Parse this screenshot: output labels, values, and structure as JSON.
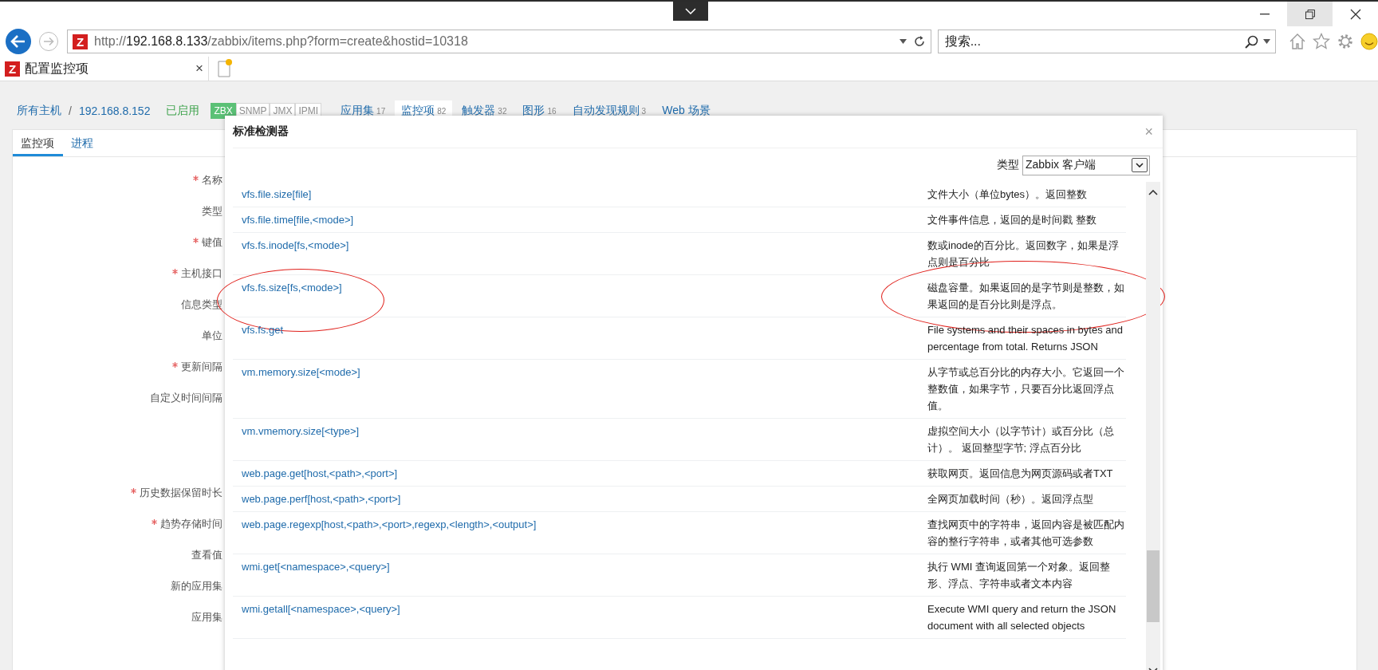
{
  "browser": {
    "favicon": "Z",
    "url": "http://**192.168.8.133**/zabbix/items.php?form=create&hostid=10318",
    "search": {
      "placeholder": "搜索..."
    }
  },
  "tab": {
    "favicon": "Z",
    "title": "配置监控项",
    "close": "×"
  },
  "host_nav": {
    "breadcrumb": [
      "所有主机",
      "192.168.8.152"
    ],
    "separator": "/",
    "status": "已启用",
    "availability": [
      {
        "label": "ZBX",
        "on": true
      },
      {
        "label": "SNMP",
        "on": false
      },
      {
        "label": "JMX",
        "on": false
      },
      {
        "label": "IPMI",
        "on": false
      }
    ],
    "tabs": [
      {
        "label": "应用集",
        "count": "17",
        "selected": false
      },
      {
        "label": "监控项",
        "count": "82",
        "selected": true
      },
      {
        "label": "触发器",
        "count": "32",
        "selected": false
      },
      {
        "label": "图形",
        "count": "16",
        "selected": false
      },
      {
        "label": "自动发现规则",
        "count": "3",
        "selected": false
      },
      {
        "label": "Web 场景",
        "selected": false
      }
    ]
  },
  "form": {
    "tabs": [
      {
        "label": "监控项",
        "selected": true
      },
      {
        "label": "进程",
        "selected": false
      }
    ],
    "fields": [
      {
        "label": "名称",
        "required": true
      },
      {
        "label": "类型",
        "required": false
      },
      {
        "label": "键值",
        "required": true
      },
      {
        "label": "主机接口",
        "required": true
      },
      {
        "label": "信息类型",
        "required": false
      },
      {
        "label": "单位",
        "required": false
      },
      {
        "label": "更新间隔",
        "required": true
      },
      {
        "label": "自定义时间间隔",
        "required": false
      },
      {
        "label": "历史数据保留时长",
        "required": true
      },
      {
        "label": "趋势存储时间",
        "required": true
      },
      {
        "label": "查看值",
        "required": false
      },
      {
        "label": "新的应用集",
        "required": false
      },
      {
        "label": "应用集",
        "required": false
      }
    ]
  },
  "dialog": {
    "title": "标准检测器",
    "close": "×",
    "type_label": "类型",
    "type_value": "Zabbix 客户端",
    "rows": [
      {
        "key": "vfs.file.size[file]",
        "description": "文件大小（单位bytes）。返回整数",
        "circled": false
      },
      {
        "key": "vfs.file.time[file,<mode>]",
        "description": "文件事件信息，返回的是时间戳 整数",
        "circled": false
      },
      {
        "key": "vfs.fs.inode[fs,<mode>]",
        "description": "数或inode的百分比。返回数字，如果是浮点则是百分比",
        "circled": false
      },
      {
        "key": "vfs.fs.size[fs,<mode>]",
        "description": "磁盘容量。如果返回的是字节则是整数，如果返回的是百分比则是浮点。",
        "circled": true
      },
      {
        "key": "vfs.fs.get",
        "description": "File systems and their spaces in bytes and percentage from total. Returns JSON",
        "circled": false
      },
      {
        "key": "vm.memory.size[<mode>]",
        "description": "从字节或总百分比的内存大小。它返回一个整数值，如果字节，只要百分比返回浮点值。",
        "circled": false
      },
      {
        "key": "vm.vmemory.size[<type>]",
        "description": "虚拟空间大小（以字节计）或百分比（总计）。 返回整型字节; 浮点百分比",
        "circled": false
      },
      {
        "key": "web.page.get[host,<path>,<port>]",
        "description": "获取网页。返回信息为网页源码或者TXT",
        "circled": false
      },
      {
        "key": "web.page.perf[host,<path>,<port>]",
        "description": "全网页加载时间（秒）。返回浮点型",
        "circled": false
      },
      {
        "key": "web.page.regexp[host,<path>,<port>,regexp,<length>,<output>]",
        "description": "查找网页中的字符串，返回内容是被匹配内容的整行字符串，或者其他可选参数",
        "circled": false
      },
      {
        "key": "wmi.get[<namespace>,<query>]",
        "description": "执行 WMI 查询返回第一个对象。返回整形、浮点、字符串或者文本内容",
        "circled": false
      },
      {
        "key": "wmi.getall[<namespace>,<query>]",
        "description": "Execute WMI query and return the JSON document with all selected objects",
        "circled": false
      }
    ]
  }
}
